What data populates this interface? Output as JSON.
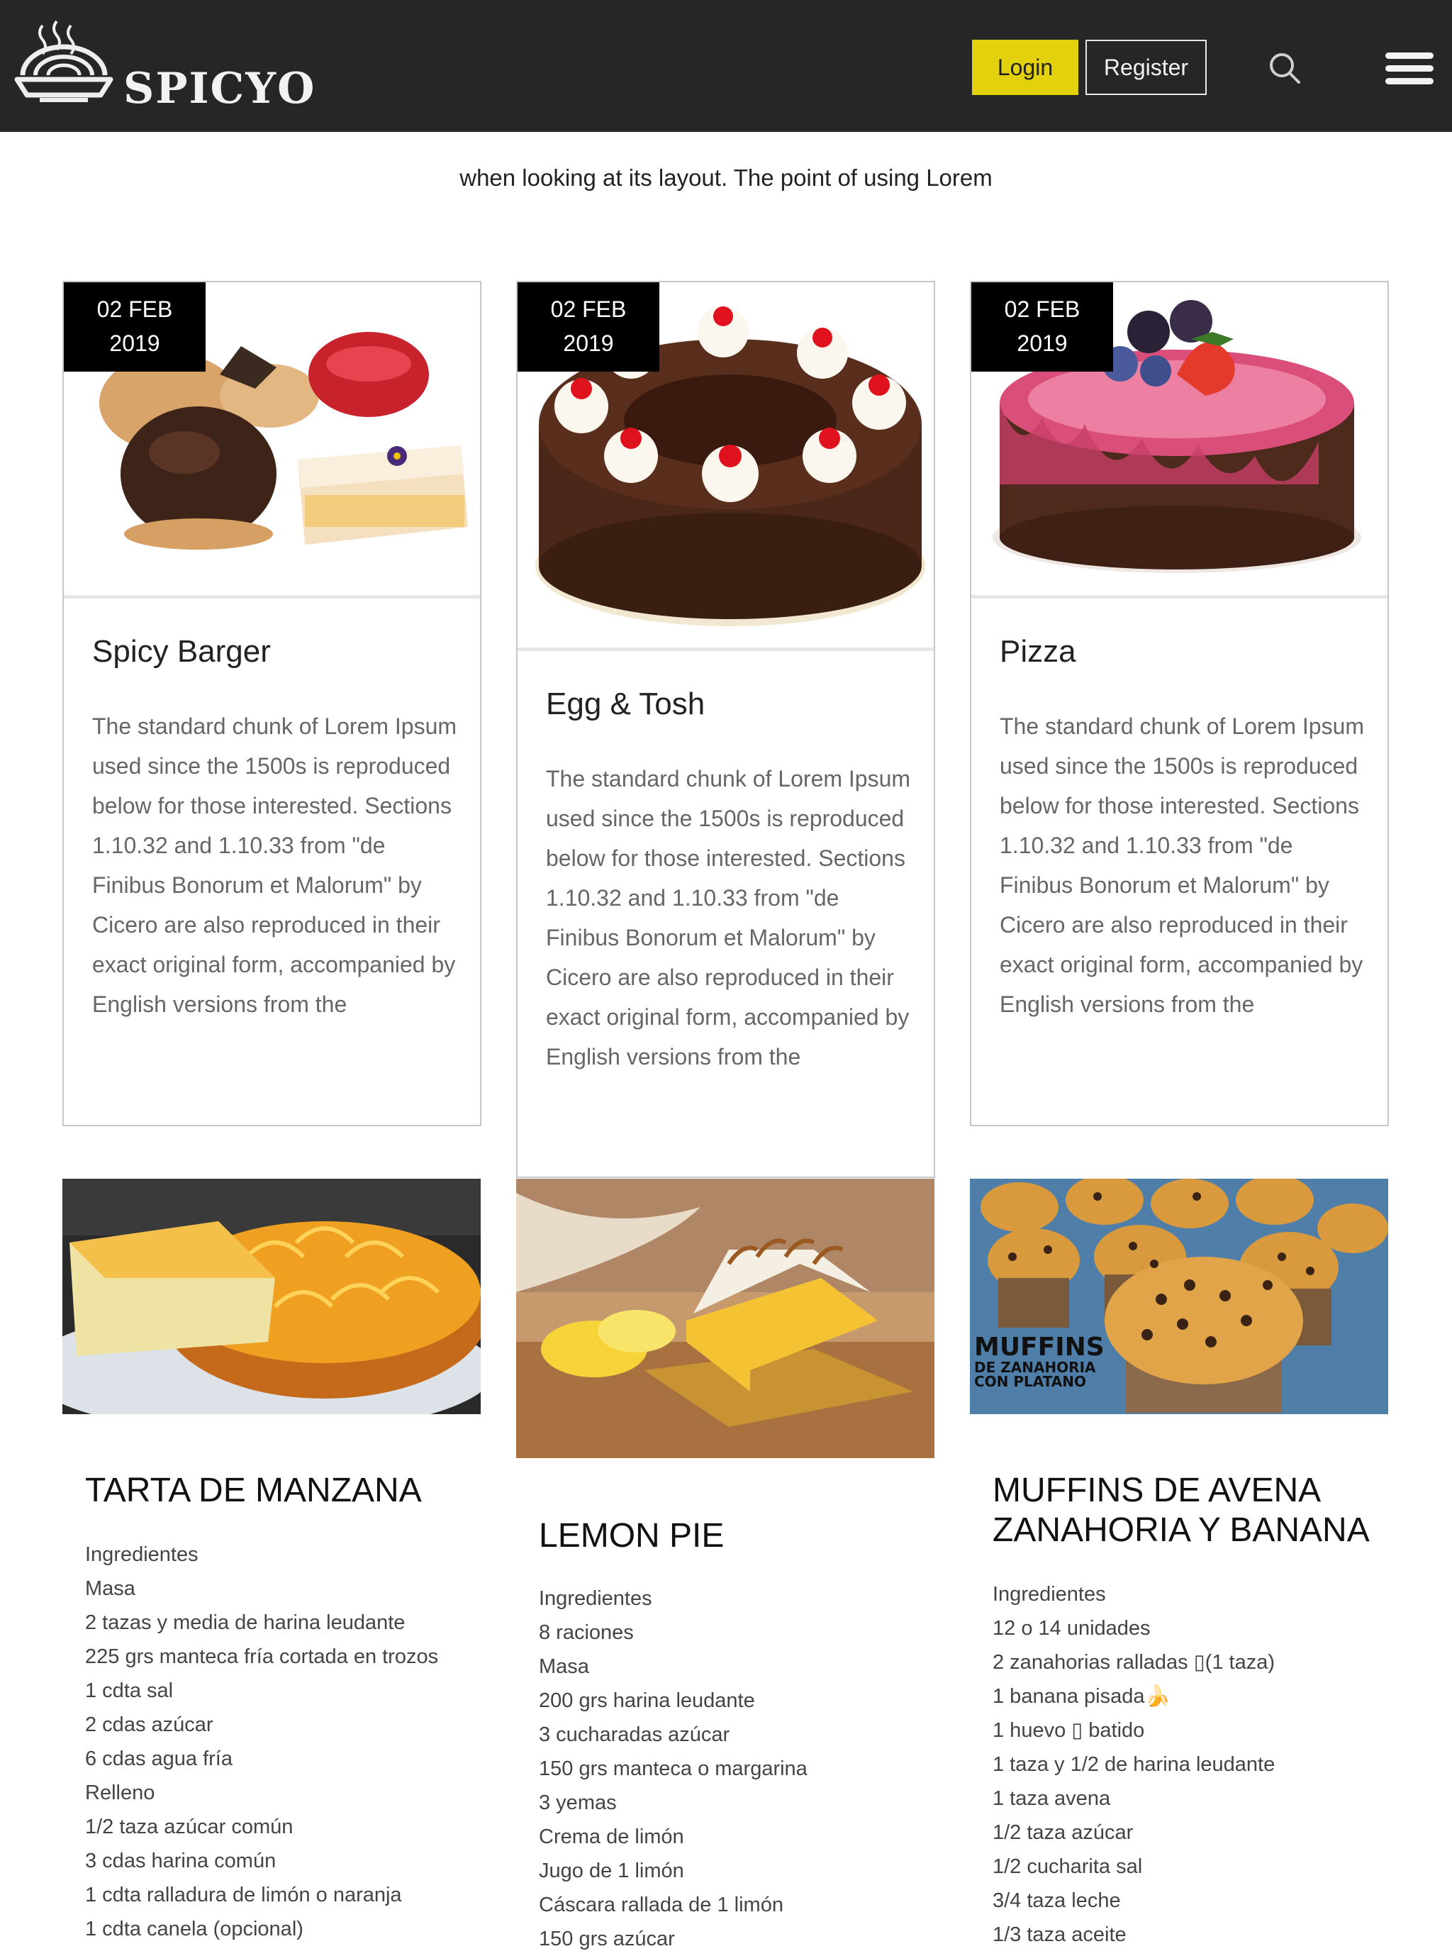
{
  "header": {
    "brand": "SPICYO",
    "login_label": "Login",
    "register_label": "Register",
    "icons": [
      "logo-bowl-icon",
      "search-icon",
      "menu-icon"
    ]
  },
  "intro": {
    "text": "when looking at its layout. The point of using Lorem"
  },
  "cards": [
    {
      "date_day": "02 FEB",
      "date_year": "2019",
      "title": "Spicy Barger",
      "body": "The standard chunk of Lorem Ipsum used since the 1500s is reproduced below for those interested. Sections 1.10.32 and 1.10.33 from \"de Finibus Bonorum et Malorum\" by Cicero are also reproduced in their exact original form, accompanied by English versions from the"
    },
    {
      "date_day": "02 FEB",
      "date_year": "2019",
      "title": "Egg & Tosh",
      "body": "The standard chunk of Lorem Ipsum used since the 1500s is reproduced below for those interested. Sections 1.10.32 and 1.10.33 from \"de Finibus Bonorum et Malorum\" by Cicero are also reproduced in their exact original form, accompanied by English versions from the"
    },
    {
      "date_day": "02 FEB",
      "date_year": "2019",
      "title": "Pizza",
      "body": "The standard chunk of Lorem Ipsum used since the 1500s is reproduced below for those interested. Sections 1.10.32 and 1.10.33 from \"de Finibus Bonorum et Malorum\" by Cicero are also reproduced in their exact original form, accompanied by English versions from the"
    }
  ],
  "recipes": [
    {
      "title": "TARTA DE MANZANA",
      "items": [
        "Ingredientes",
        "Masa",
        "2 tazas y media de harina leudante",
        "225 grs manteca fría cortada en trozos",
        "1 cdta sal",
        "2 cdas azúcar",
        "6 cdas agua fría",
        "Relleno",
        "1/2 taza azúcar común",
        "3 cdas harina común",
        "1 cdta ralladura de limón o naranja",
        "1 cdta canela (opcional)"
      ]
    },
    {
      "title": "LEMON PIE",
      "items": [
        "Ingredientes",
        "8 raciones",
        "Masa",
        "200 grs harina leudante",
        "3 cucharadas azúcar",
        "150 grs manteca o margarina",
        "3 yemas",
        "Crema de limón",
        "Jugo de 1 limón",
        "Cáscara rallada de 1 limón",
        "150 grs azúcar"
      ]
    },
    {
      "title": "MUFFINS DE AVENA ZANAHORIA Y BANANA",
      "items": [
        "Ingredientes",
        "12 o 14 unidades",
        "2 zanahorias ralladas ▯(1 taza)",
        "1 banana pisada🍌",
        "1 huevo ▯ batido",
        "1 taza y 1/2 de harina leudante",
        "1 taza avena",
        "1/2 taza azúcar",
        "1/2 cucharita sal",
        "3/4 taza leche",
        "1/3 taza aceite"
      ],
      "image_caption": [
        "MUFFINS",
        "DE ZANAHORIA",
        "CON PLATANO"
      ]
    }
  ]
}
